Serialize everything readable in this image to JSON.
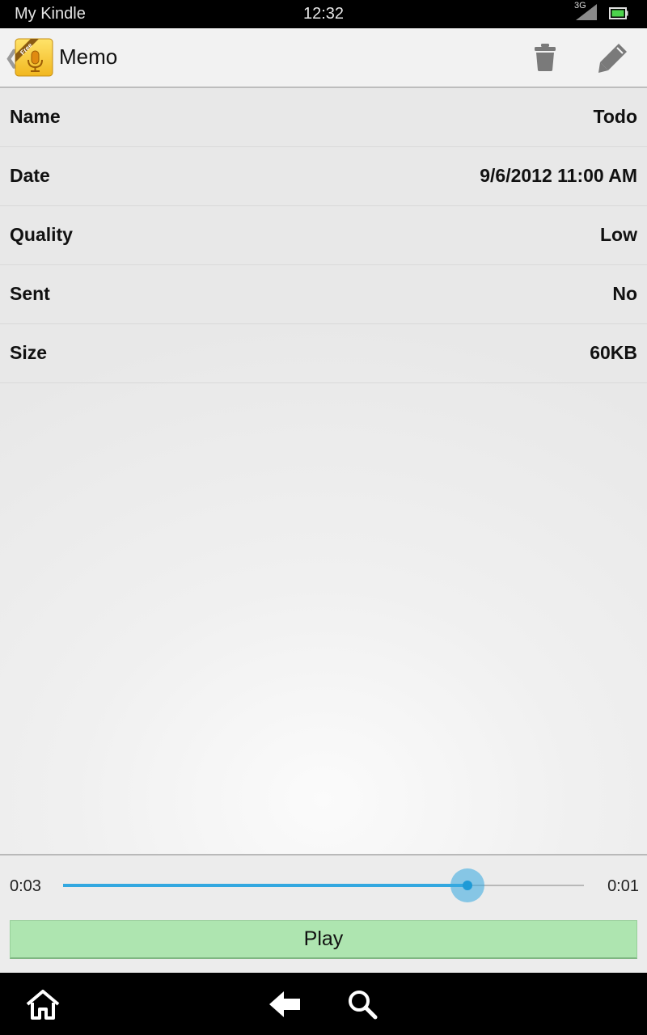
{
  "status_bar": {
    "carrier": "My Kindle",
    "time": "12:32",
    "network": "3G"
  },
  "action_bar": {
    "title": "Memo",
    "app_badge": "Free",
    "up_icon": "chevron-left-icon",
    "actions": [
      {
        "name": "delete",
        "icon": "trash-icon"
      },
      {
        "name": "edit",
        "icon": "pencil-icon"
      }
    ]
  },
  "details": [
    {
      "label": "Name",
      "value": "Todo"
    },
    {
      "label": "Date",
      "value": "9/6/2012 11:00 AM"
    },
    {
      "label": "Quality",
      "value": "Low"
    },
    {
      "label": "Sent",
      "value": "No"
    },
    {
      "label": "Size",
      "value": "60KB"
    }
  ],
  "player": {
    "elapsed": "0:03",
    "remaining": "0:01",
    "progress_fraction": 0.777,
    "play_label": "Play"
  },
  "nav_bar": {
    "icons": [
      "home-icon",
      "back-arrow-icon",
      "search-icon"
    ]
  },
  "colors": {
    "accent_blue": "#33a8e0",
    "play_button_green": "#aee5b0",
    "background": "#e9e9e9"
  }
}
